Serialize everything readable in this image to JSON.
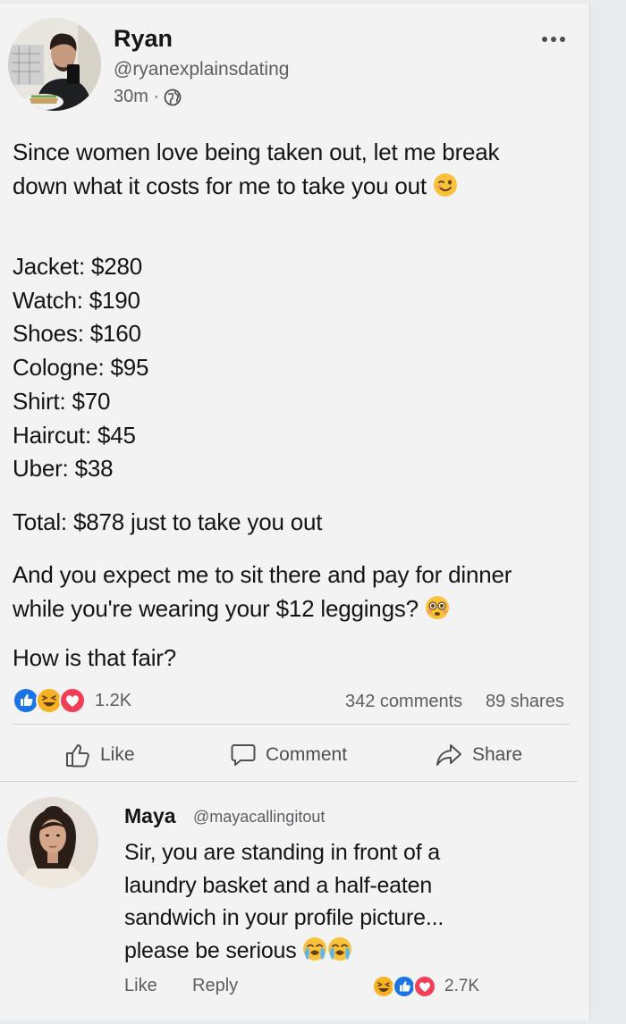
{
  "post": {
    "author": "Ryan",
    "handle": "@ryanexplainsdating",
    "time": "30m ·",
    "audience_icon": "globe-icon",
    "intro": "Since women love being taken out, let me break down what it costs for me to take you out",
    "intro_emoji": "winking-face",
    "items": [
      "Jacket: $280",
      "Watch: $190",
      "Shoes: $160",
      "Cologne: $95",
      "Shirt: $70",
      "Haircut: $45",
      "Uber: $38"
    ],
    "total": "Total: $878 just to take you out",
    "complaint": "And you expect me to sit there and pay for dinner while you're wearing your $12 leggings?",
    "complaint_emoji": "flushed-face",
    "question": "How is that fair?"
  },
  "stats": {
    "reactions": "1.2K",
    "comments": "342 comments",
    "shares": "89 shares"
  },
  "actions": {
    "like": "Like",
    "comment": "Comment",
    "share": "Share"
  },
  "comment": {
    "author": "Maya",
    "handle": "@mayacallingitout",
    "text": "Sir, you are standing in front of a laundry basket and a half-eaten sandwich in your profile picture... please be serious",
    "emoji": "crying-faces",
    "like": "Like",
    "reply": "Reply",
    "reactions": "2.7K"
  },
  "colors": {
    "like_blue": "#1b74e4",
    "love_red": "#f33e58",
    "haha_yellow": "#f7b125",
    "text": "#141414",
    "muted": "#5d5e61"
  }
}
